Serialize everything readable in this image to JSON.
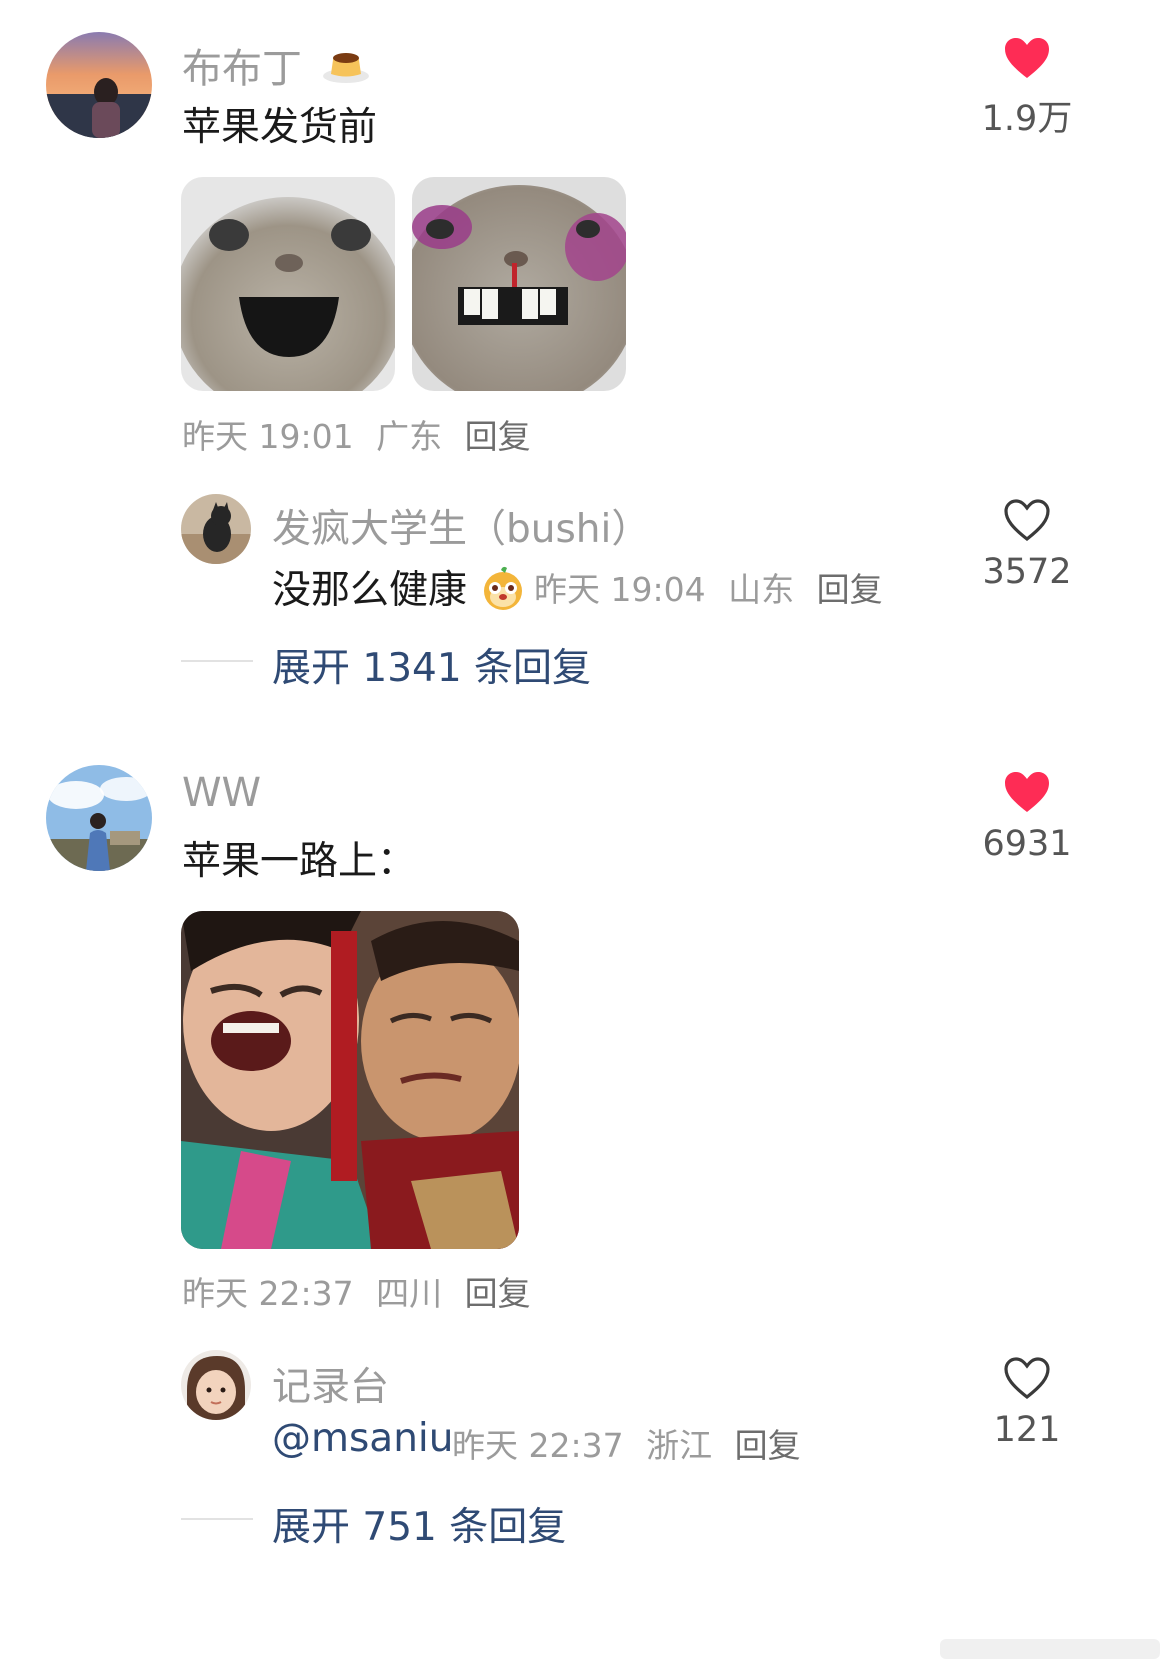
{
  "comments": [
    {
      "username": "布布丁",
      "username_emoji": "pudding-icon",
      "text": "苹果发货前",
      "likes": "1.9万",
      "liked": true,
      "meta": {
        "time": "昨天 19:01",
        "location": "广东",
        "reply": "回复"
      },
      "reply": {
        "username": "发疯大学生（bushi）",
        "text": "没那么健康",
        "text_emoji": "hamster-emoji-icon",
        "meta": {
          "time": "昨天 19:04",
          "location": "山东",
          "reply": "回复"
        },
        "likes": "3572",
        "liked": false
      },
      "expand": "展开 1341 条回复"
    },
    {
      "username": "WW",
      "text": "苹果一路上：",
      "likes": "6931",
      "liked": true,
      "meta": {
        "time": "昨天 22:37",
        "location": "四川",
        "reply": "回复"
      },
      "reply": {
        "username": "记录台",
        "text": "@msaniu",
        "meta": {
          "time": "昨天 22:37",
          "location": "浙江",
          "reply": "回复"
        },
        "likes": "121",
        "liked": false
      },
      "expand": "展开 751 条回复"
    }
  ],
  "colors": {
    "like_active": "#fe2c55",
    "link": "#2f4a74",
    "muted": "#9b9b9b"
  }
}
